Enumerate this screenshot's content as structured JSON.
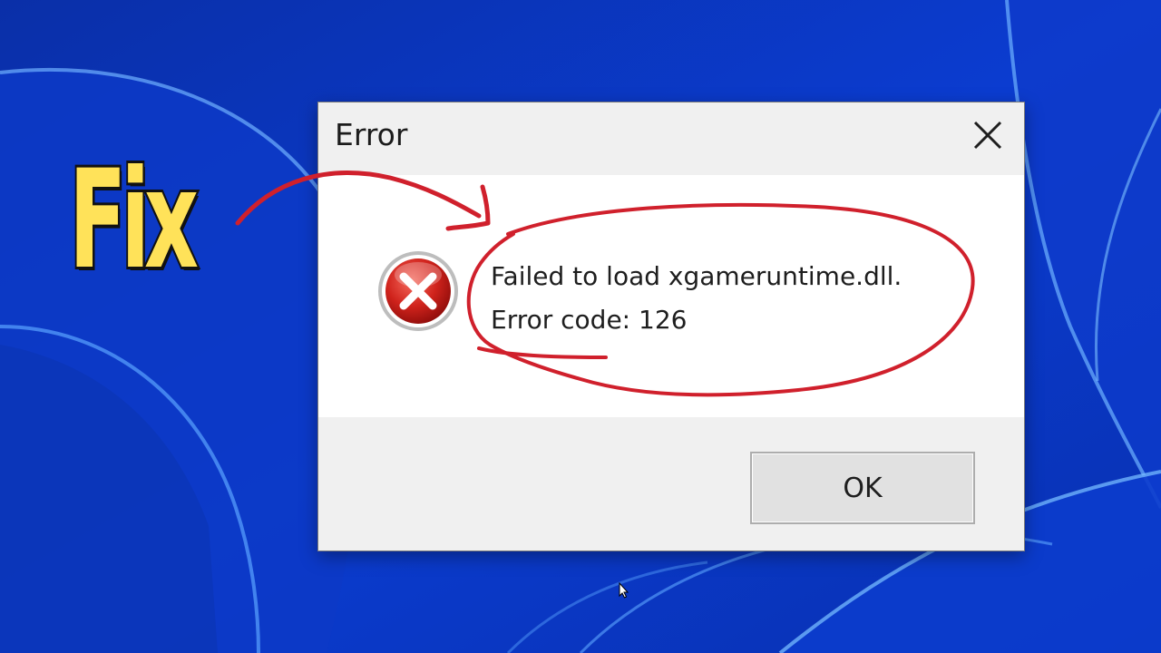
{
  "overlay": {
    "label": "Fix",
    "label_color": "#ffe259",
    "annotation_color": "#d0202c"
  },
  "dialog": {
    "title": "Error",
    "close_icon": "close-icon",
    "icon": "error-x-icon",
    "message_line1": "Failed to load xgameruntime.dll.",
    "message_line2": "Error code: 126",
    "ok_label": "OK"
  },
  "desktop": {
    "wallpaper": "windows-11-bloom-blue",
    "accent": "#0b34b8"
  }
}
